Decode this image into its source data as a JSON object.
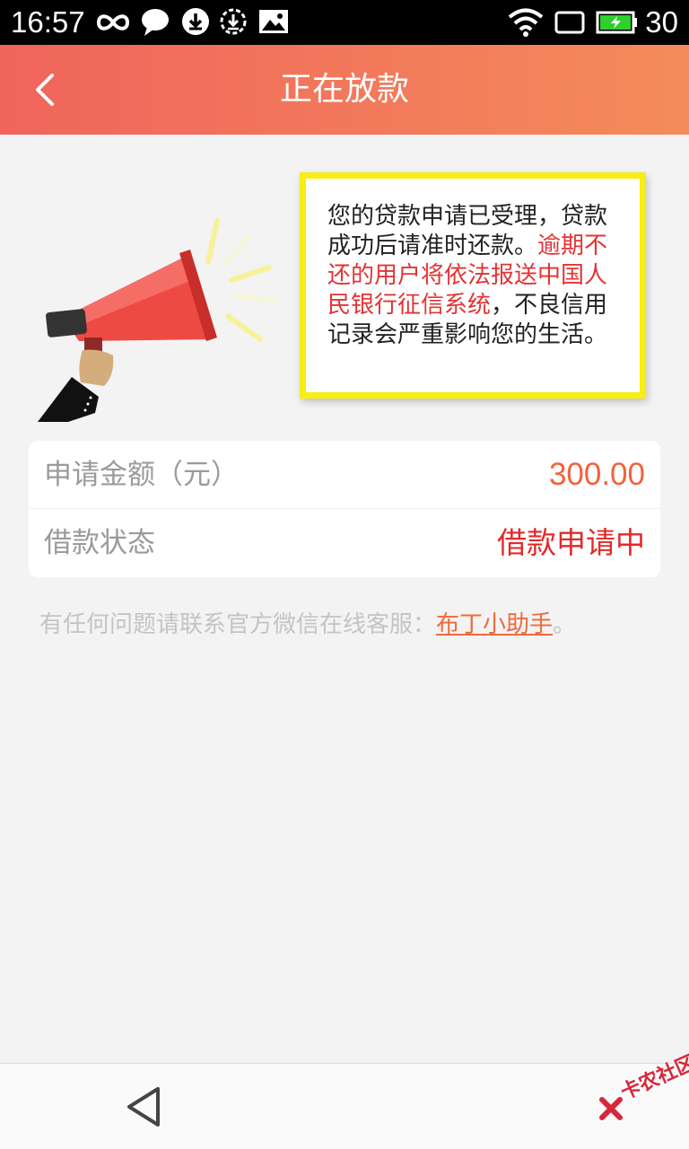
{
  "status_bar": {
    "time": "16:57",
    "battery_level": "30",
    "icons": [
      "infinity-icon",
      "chat-icon",
      "download-icon",
      "download-circle-icon",
      "image-icon",
      "wifi-icon",
      "screen-icon",
      "battery-icon"
    ]
  },
  "header": {
    "title": "正在放款",
    "back_icon": "chevron-left-icon"
  },
  "notice": {
    "text_normal": "您的贷款申请已受理，贷款成功后请准时还款。",
    "text_warning": "逾期不还的用户将依法报送中国人民银行征信系统",
    "text_tail": "，不良信用记录会严重影响您的生活。",
    "border_color": "#f7ee12",
    "warning_color": "#e23434"
  },
  "loan": {
    "amount_label": "申请金额（元）",
    "amount_value": "300.00",
    "status_label": "借款状态",
    "status_value": "借款申请中"
  },
  "contact": {
    "prefix": "有任何问题请联系官方微信在线客服：",
    "link": "布丁小助手",
    "suffix": "。"
  },
  "nav_bar": {
    "back_icon": "triangle-back-icon"
  },
  "watermark": {
    "text": "卡农社区"
  },
  "colors": {
    "header_start": "#f0645c",
    "header_end": "#f48c5a",
    "amount": "#f0643a",
    "status": "#e22a2a",
    "link": "#ee6a3a"
  }
}
